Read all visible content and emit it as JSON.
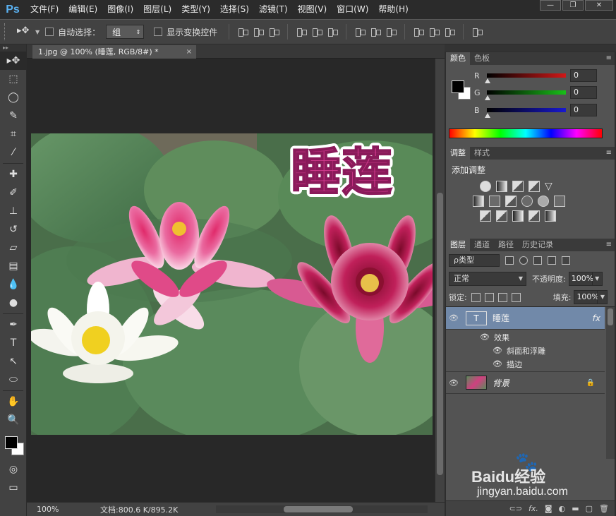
{
  "app": {
    "logo": "Ps"
  },
  "menu": [
    "文件(F)",
    "编辑(E)",
    "图像(I)",
    "图层(L)",
    "类型(Y)",
    "选择(S)",
    "滤镜(T)",
    "视图(V)",
    "窗口(W)",
    "帮助(H)"
  ],
  "window_controls": {
    "minimize": "—",
    "restore": "❐",
    "close": "✕"
  },
  "options": {
    "auto_select_label": "自动选择：",
    "auto_select_value": "组",
    "show_transform_label": "显示变换控件"
  },
  "document": {
    "tab_title": "1.jpg @ 100% (睡莲, RGB/8#) *",
    "close": "×",
    "text_overlay": "睡莲"
  },
  "status": {
    "zoom": "100%",
    "doc_info": "文档:800.6 K/895.2K"
  },
  "color_panel": {
    "tabs": [
      "颜色",
      "色板"
    ],
    "active_tab": 0,
    "sliders": [
      {
        "label": "R",
        "value": "0",
        "color": "#d01818"
      },
      {
        "label": "G",
        "value": "0",
        "color": "#18c018"
      },
      {
        "label": "B",
        "value": "0",
        "color": "#1818d0"
      }
    ]
  },
  "adjust_panel": {
    "tabs": [
      "调整",
      "样式"
    ],
    "active_tab": 0,
    "title": "添加调整"
  },
  "layers_panel": {
    "tabs": [
      "图层",
      "通道",
      "路径",
      "历史记录"
    ],
    "active_tab": 0,
    "filter": "ρ类型",
    "blend_mode": "正常",
    "opacity_label": "不透明度:",
    "opacity_value": "100%",
    "lock_label": "锁定:",
    "fill_label": "填充:",
    "fill_value": "100%",
    "layers": [
      {
        "name": "睡莲",
        "thumb": "T",
        "fx": "fx",
        "effects_label": "效果",
        "effects": [
          "斜面和浮雕",
          "描边"
        ]
      },
      {
        "name": "背景",
        "thumb": "",
        "locked": "🔒"
      }
    ]
  },
  "watermark": {
    "brand": "Baidu经验",
    "url": "jingyan.baidu.com"
  },
  "colors": {
    "accent": "#7189a9",
    "menu_bg": "#2b2b2b",
    "panel_bg": "#535353"
  }
}
